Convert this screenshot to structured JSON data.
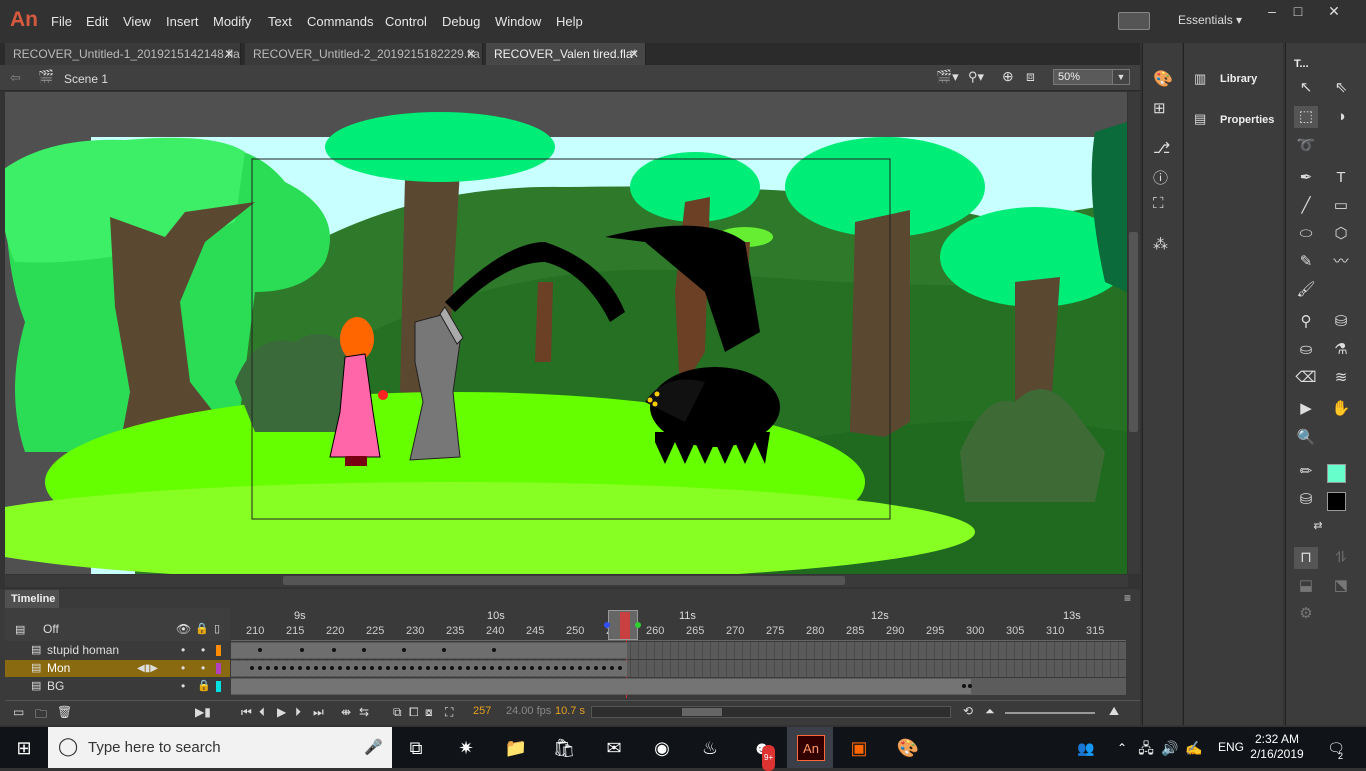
{
  "app": {
    "logo": "An",
    "workspace": "Essentials"
  },
  "menu": [
    "File",
    "Edit",
    "View",
    "Insert",
    "Modify",
    "Text",
    "Commands",
    "Control",
    "Debug",
    "Window",
    "Help"
  ],
  "tabs": [
    {
      "label": "RECOVER_Untitled-1_2019215142148.fla"
    },
    {
      "label": "RECOVER_Untitled-2_2019215182229.fla"
    },
    {
      "label": "RECOVER_Valen tired.fla*"
    }
  ],
  "editbar": {
    "scene": "Scene 1",
    "zoom": "50%"
  },
  "timeline": {
    "title": "Timeline",
    "off_label": "Off",
    "layers": [
      {
        "name": "stupid homan",
        "color": "#ff8c00"
      },
      {
        "name": "Mon",
        "color": "#b040c0",
        "selected": true
      },
      {
        "name": "BG",
        "color": "#00e0e0",
        "locked": true
      }
    ],
    "seconds": [
      "9s",
      "10s",
      "11s",
      "12s",
      "13s"
    ],
    "frame_ticks": [
      "210",
      "215",
      "220",
      "225",
      "230",
      "235",
      "240",
      "245",
      "250",
      "255",
      "260",
      "265",
      "270",
      "275",
      "280",
      "285",
      "290",
      "295",
      "300",
      "305",
      "310",
      "315"
    ],
    "current_frame": "257",
    "fps": "24.00 fps",
    "time": "10.7 s"
  },
  "panels": {
    "library": "Library",
    "properties": "Properties",
    "tools_title": "T..."
  },
  "colors": {
    "stroke": "#000000",
    "fill": "#66ffcc"
  },
  "taskbar": {
    "search_placeholder": "Type here to search",
    "language": "ENG",
    "time": "2:32 AM",
    "date": "2/16/2019",
    "notifications": "2",
    "badge": "9+"
  }
}
